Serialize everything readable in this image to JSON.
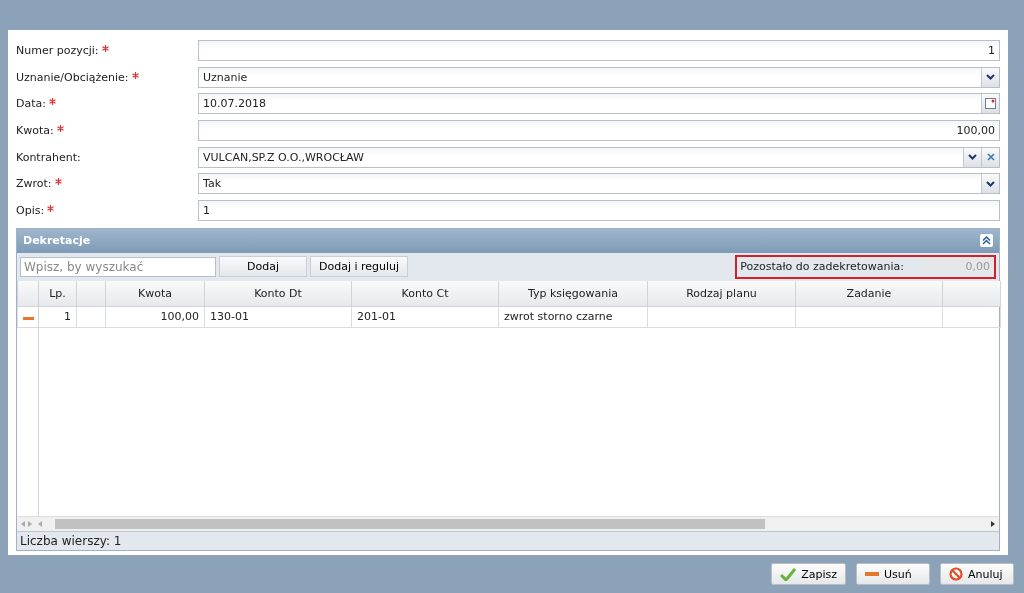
{
  "form": {
    "fields": [
      {
        "label": "Numer pozycji:",
        "required": true,
        "kind": "number",
        "value": "1"
      },
      {
        "label": "Uznanie/Obciążenie:",
        "required": true,
        "kind": "select",
        "value": "Uznanie"
      },
      {
        "label": "Data:",
        "required": true,
        "kind": "date",
        "value": "10.07.2018"
      },
      {
        "label": "Kwota:",
        "required": true,
        "kind": "number",
        "value": "100,00"
      },
      {
        "label": "Kontrahent:",
        "required": false,
        "kind": "combo",
        "value": "VULCAN,SP.Z O.O.,WROCŁAW"
      },
      {
        "label": "Zwrot:",
        "required": true,
        "kind": "select",
        "value": "Tak"
      },
      {
        "label": "Opis:",
        "required": true,
        "kind": "text",
        "value": "1"
      }
    ]
  },
  "panel": {
    "title": "Dekretacje",
    "search": {
      "placeholder": "Wpisz, by wyszukać"
    },
    "buttons": [
      "Dodaj",
      "Dodaj i reguluj"
    ],
    "remaining": {
      "label": "Pozostało do zadekretowania:",
      "value": "0,00"
    },
    "table": {
      "columns": [
        "Lp.",
        "",
        "Kwota",
        "Konto Dt",
        "Konto Ct",
        "Typ księgowania",
        "Rodzaj planu",
        "Zadanie",
        ""
      ],
      "rows": [
        {
          "cells": [
            "1",
            "",
            "100,00",
            "130-01",
            "201-01",
            "zwrot storno czarne",
            "",
            "",
            ""
          ]
        }
      ]
    },
    "footer": "Liczba wierszy: 1"
  },
  "buttons": [
    {
      "label": "Zapisz",
      "kind": "save"
    },
    {
      "label": "Usuń",
      "kind": "delete"
    },
    {
      "label": "Anuluj",
      "kind": "cancel"
    }
  ]
}
